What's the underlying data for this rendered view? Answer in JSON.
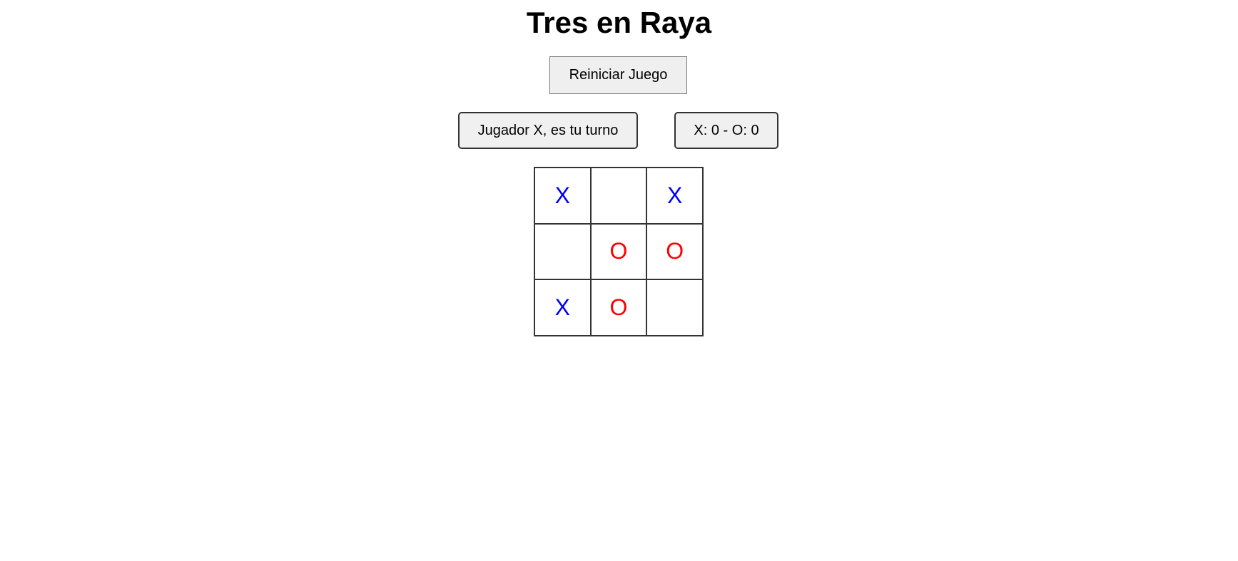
{
  "title": "Tres en Raya",
  "restart_label": "Reiniciar Juego",
  "status": "Jugador X, es tu turno",
  "score": "X: 0 - O: 0",
  "colors": {
    "x": "#0000ff",
    "o": "#ff0000"
  },
  "board": [
    "X",
    "",
    "X",
    "",
    "O",
    "O",
    "X",
    "O",
    ""
  ]
}
